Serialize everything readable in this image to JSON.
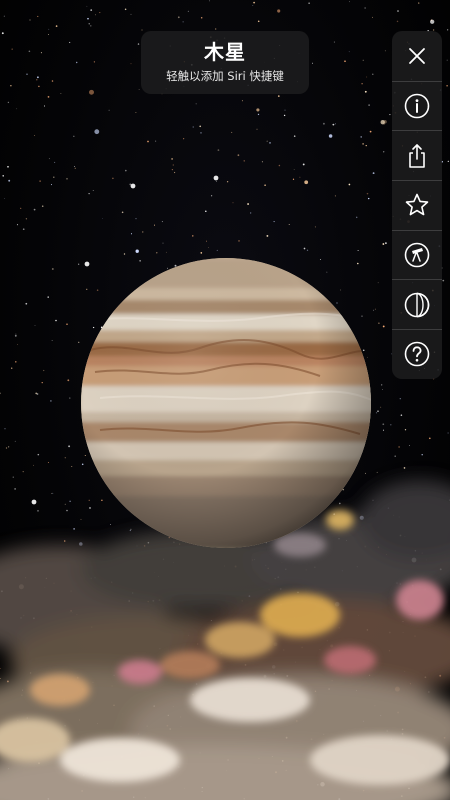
{
  "title_card": {
    "planet_name": "木星",
    "hint": "轻触以添加 Siri 快捷键"
  },
  "toolbar": {
    "buttons": [
      {
        "icon": "close-icon",
        "action": "close"
      },
      {
        "icon": "info-icon",
        "action": "info"
      },
      {
        "icon": "share-icon",
        "action": "share"
      },
      {
        "icon": "star-icon",
        "action": "favorite"
      },
      {
        "icon": "telescope-icon",
        "action": "observe"
      },
      {
        "icon": "phase-icon",
        "action": "phases"
      },
      {
        "icon": "help-icon",
        "action": "help"
      }
    ]
  },
  "colors": {
    "panel_background": "#1c1c1e",
    "icon_color": "#ffffff",
    "planet_band_light": "#d9cbb4",
    "planet_band_dark": "#8a5a36"
  }
}
